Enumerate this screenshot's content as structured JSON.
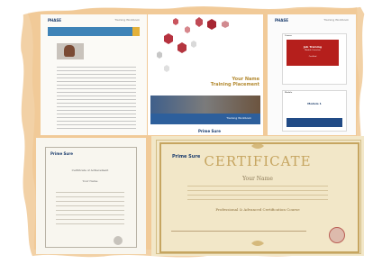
{
  "pages": {
    "manual": {
      "logo": "PHASE",
      "tag": "Training Workbook"
    },
    "cover": {
      "title_line1": "Your Name",
      "title_line2": "Training Placement",
      "label": "Training Workbook",
      "logo": "Prime Sure"
    },
    "module_page": {
      "logo": "PHASE",
      "tag": "Training Workbook",
      "box1_caption": "Course",
      "red_title": "Job Training",
      "red_subtitle": "Module Overview",
      "red_note": "Certified",
      "box2_caption": "Module",
      "module_title": "Module 1"
    },
    "certificate_small": {
      "logo": "Prime Sure",
      "heading": "Certificate of Achievement",
      "name": "Your Name"
    },
    "certificate_large": {
      "logo": "Prime Sure",
      "title": "CERTIFICATE",
      "name": "Your Name",
      "course": "Professional & Advanced Certification Course"
    }
  }
}
